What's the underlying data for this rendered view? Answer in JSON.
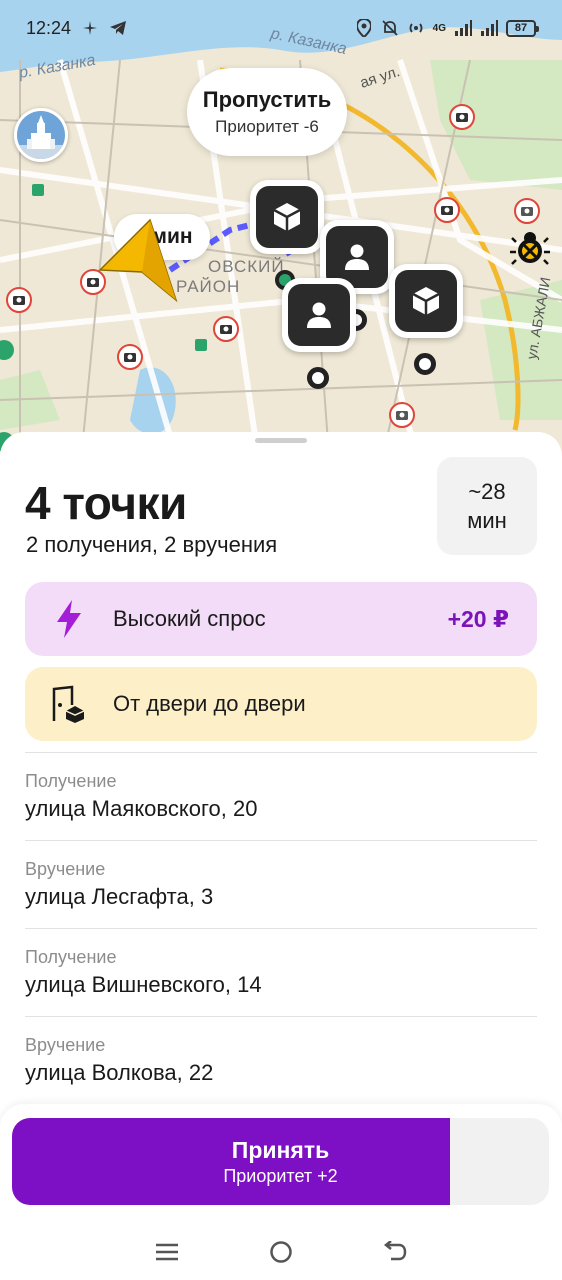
{
  "status_bar": {
    "time": "12:24",
    "battery": "87",
    "network": "4G"
  },
  "map": {
    "labels": {
      "river": "р. Казанка",
      "street_top": "ая ул.",
      "district_line1": "ОВСКИЙ",
      "district_line2": "РАЙОН",
      "street_right": "ул. АБЖАЛИ"
    },
    "skip": {
      "title": "Пропустить",
      "subtitle": "Приоритет -6"
    },
    "time_chip": "мин"
  },
  "order": {
    "title": "4 точки",
    "subtitle": "2 получения, 2 вручения",
    "eta_line1": "~28",
    "eta_line2": "мин"
  },
  "badges": {
    "demand": {
      "label": "Высокий спрос",
      "value": "+20 ₽",
      "icon": "lightning-icon",
      "color": "#f3dcf8"
    },
    "door": {
      "label": "От двери до двери",
      "icon": "door-box-icon",
      "color": "#fdf0c9"
    }
  },
  "stops": [
    {
      "type": "Получение",
      "address": "улица Маяковского, 20"
    },
    {
      "type": "Вручение",
      "address": "улица Лесгафта, 3"
    },
    {
      "type": "Получение",
      "address": "улица Вишневского, 14"
    },
    {
      "type": "Вручение",
      "address": "улица Волкова, 22"
    }
  ],
  "accept": {
    "title": "Принять",
    "subtitle": "Приоритет +2",
    "progress": 0.815,
    "color": "#7d0fc4"
  },
  "navbar": {
    "icons": [
      "menu-icon",
      "home-icon",
      "back-icon"
    ]
  }
}
